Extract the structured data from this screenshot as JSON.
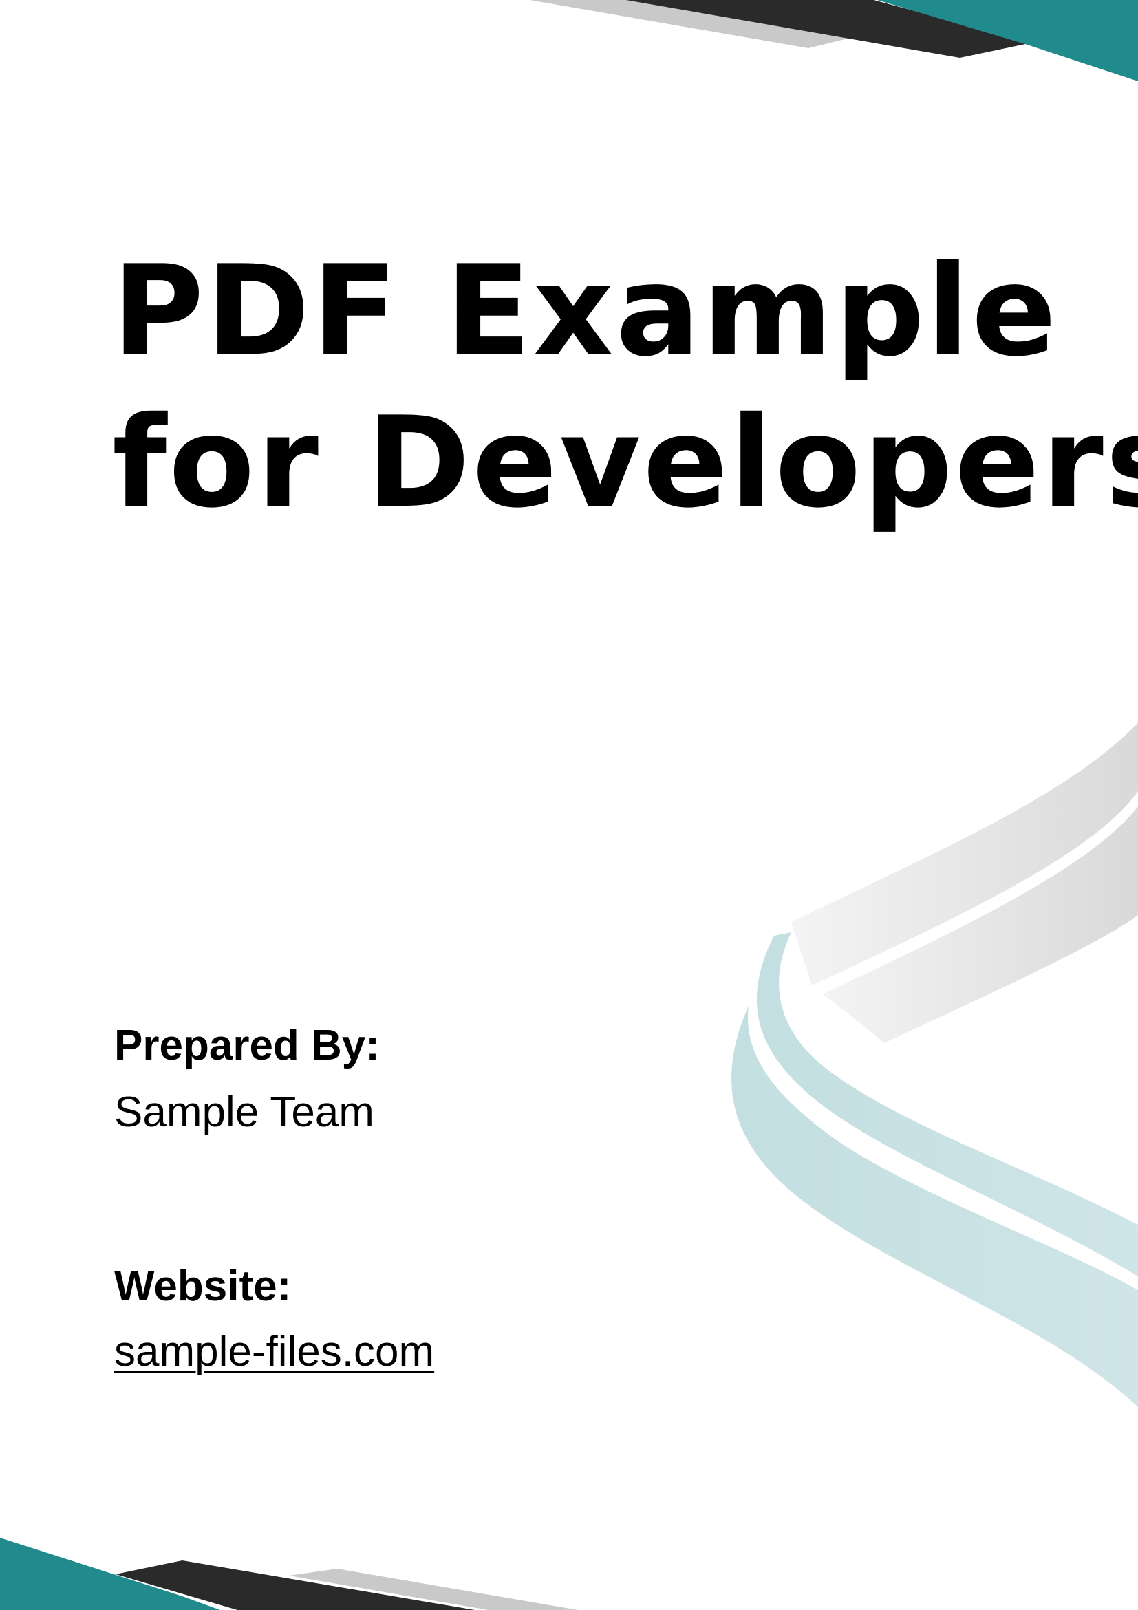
{
  "title": {
    "line1": "PDF Example",
    "line2": "for Developers"
  },
  "prepared_by": {
    "label": "Prepared By:",
    "value": "Sample Team"
  },
  "website": {
    "label": "Website:",
    "link_text": "sample-files.com"
  },
  "colors": {
    "accent_teal": "#1f898b",
    "dark_band": "#2a2a2a",
    "light_gray_band": "#c8c8c8",
    "ribbon_gray": "#e2e2e2",
    "ribbon_teal_light": "#c4e1e3",
    "text": "#000000"
  }
}
